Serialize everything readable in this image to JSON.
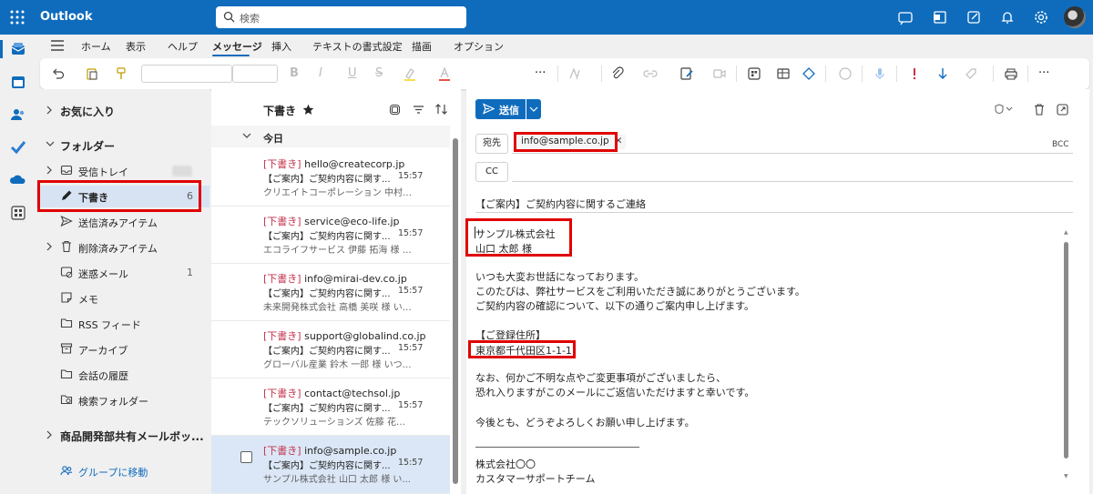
{
  "app": {
    "title": "Outlook"
  },
  "search": {
    "placeholder": "検索"
  },
  "ribbon": {
    "tabs": [
      "ホーム",
      "表示",
      "ヘルプ",
      "メッセージ",
      "挿入",
      "テキストの書式設定",
      "描画",
      "オプション"
    ],
    "active_tab": "メッセージ"
  },
  "folders": {
    "favorites_label": "お気に入り",
    "folders_label": "フォルダー",
    "items": [
      {
        "label": "受信トレイ",
        "count": ""
      },
      {
        "label": "下書き",
        "count": "6"
      },
      {
        "label": "送信済みアイテム",
        "count": ""
      },
      {
        "label": "削除済みアイテム",
        "count": ""
      },
      {
        "label": "迷惑メール",
        "count": "1"
      },
      {
        "label": "メモ",
        "count": ""
      },
      {
        "label": "RSS フィード",
        "count": ""
      },
      {
        "label": "アーカイブ",
        "count": ""
      },
      {
        "label": "会話の履歴",
        "count": ""
      },
      {
        "label": "検索フォルダー",
        "count": ""
      }
    ],
    "shared_label": "商品開発部共有メールボッ...",
    "groups_link": "グループに移動"
  },
  "message_list": {
    "title": "下書き",
    "day_label": "今日",
    "messages": [
      {
        "tag": "[下書き]",
        "to": "hello@createcorp.jp",
        "subject": "【ご案内】ご契約内容に関す...",
        "time": "15:57",
        "preview": "クリエイトコーポレーション 中村 美優 ..."
      },
      {
        "tag": "[下書き]",
        "to": "service@eco-life.jp",
        "subject": "【ご案内】ご契約内容に関す...",
        "time": "15:57",
        "preview": "エコライフサービス 伊藤 拓海 様 いつ..."
      },
      {
        "tag": "[下書き]",
        "to": "info@mirai-dev.co.jp",
        "subject": "【ご案内】ご契約内容に関す...",
        "time": "15:57",
        "preview": "未来開発株式会社 高橋 美咲 様 いつ..."
      },
      {
        "tag": "[下書き]",
        "to": "support@globalind.co.jp",
        "subject": "【ご案内】ご契約内容に関す...",
        "time": "15:57",
        "preview": "グローバル産業 鈴木 一郎 様 いつも..."
      },
      {
        "tag": "[下書き]",
        "to": "contact@techsol.jp",
        "subject": "【ご案内】ご契約内容に関す...",
        "time": "15:57",
        "preview": "テックソリューションズ 佐藤 花子 様 ..."
      },
      {
        "tag": "[下書き]",
        "to": "info@sample.co.jp",
        "subject": "【ご案内】ご契約内容に関す...",
        "time": "15:57",
        "preview": "サンプル株式会社 山口 太郎 様 い..."
      }
    ]
  },
  "compose": {
    "send_label": "送信",
    "to_label": "宛先",
    "cc_label": "CC",
    "bcc_label": "BCC",
    "recipient": "info@sample.co.jp",
    "subject": "【ご案内】ご契約内容に関するご連絡",
    "body": [
      "サンプル株式会社",
      "山口 太郎 様",
      "いつも大変お世話になっております。",
      "このたびは、弊社サービスをご利用いただき誠にありがとうございます。",
      "ご契約内容の確認について、以下の通りご案内申し上げます。",
      "【ご登録住所】",
      "東京都千代田区1-1-1",
      "なお、何かご不明な点やご変更事項がございましたら、",
      "恐れ入りますがこのメールにご返信いただけますと幸いです。",
      "今後とも、どうぞよろしくお願い申し上げます。",
      "株式会社〇〇",
      "カスタマーサポートチーム"
    ]
  },
  "colors": {
    "brand": "#0f6cbd",
    "highlight_box": "#e00000",
    "draft_tag": "#c4314b"
  }
}
